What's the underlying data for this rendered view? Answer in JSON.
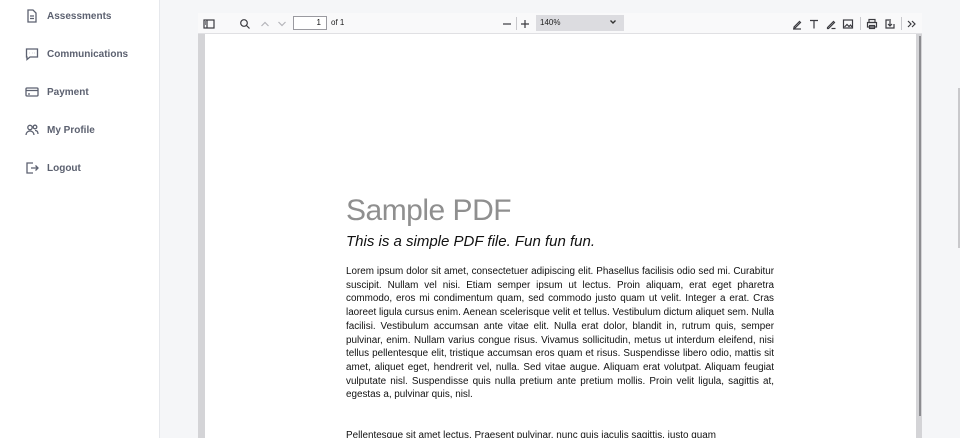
{
  "sidebar": {
    "items": [
      {
        "label": "Assessments",
        "icon": "document-icon"
      },
      {
        "label": "Communications",
        "icon": "chat-icon"
      },
      {
        "label": "Payment",
        "icon": "credit-card-icon"
      },
      {
        "label": "My Profile",
        "icon": "users-icon"
      },
      {
        "label": "Logout",
        "icon": "logout-icon"
      }
    ]
  },
  "toolbar": {
    "page_number": "1",
    "page_of": "of 1",
    "zoom": "140%"
  },
  "pdf": {
    "title": "Sample PDF",
    "subtitle": "This is a simple PDF file. Fun fun fun.",
    "paragraph1": "Lorem ipsum dolor sit amet, consectetuer adipiscing elit. Phasellus facilisis odio sed mi. Curabitur suscipit. Nullam vel nisi. Etiam semper ipsum ut lectus. Proin aliquam, erat eget pharetra commodo, eros mi condimentum quam, sed commodo justo quam ut velit. Integer a erat. Cras laoreet ligula cursus enim. Aenean scelerisque velit et tellus. Vestibulum dictum aliquet sem. Nulla facilisi. Vestibulum accumsan ante vitae elit. Nulla erat dolor, blandit in, rutrum quis, semper pulvinar, enim. Nullam varius congue risus. Vivamus sollicitudin, metus ut interdum eleifend, nisi tellus pellentesque elit, tristique accumsan eros quam et risus. Suspendisse libero odio, mattis sit amet, aliquet eget, hendrerit vel, nulla. Sed vitae augue. Aliquam erat volutpat. Aliquam feugiat vulputate nisl. Suspendisse quis nulla pretium ante pretium mollis. Proin velit ligula, sagittis at, egestas a, pulvinar quis, nisl.",
    "paragraph2": "Pellentesque sit amet lectus. Praesent pulvinar, nunc quis iaculis sagittis, justo quam"
  }
}
